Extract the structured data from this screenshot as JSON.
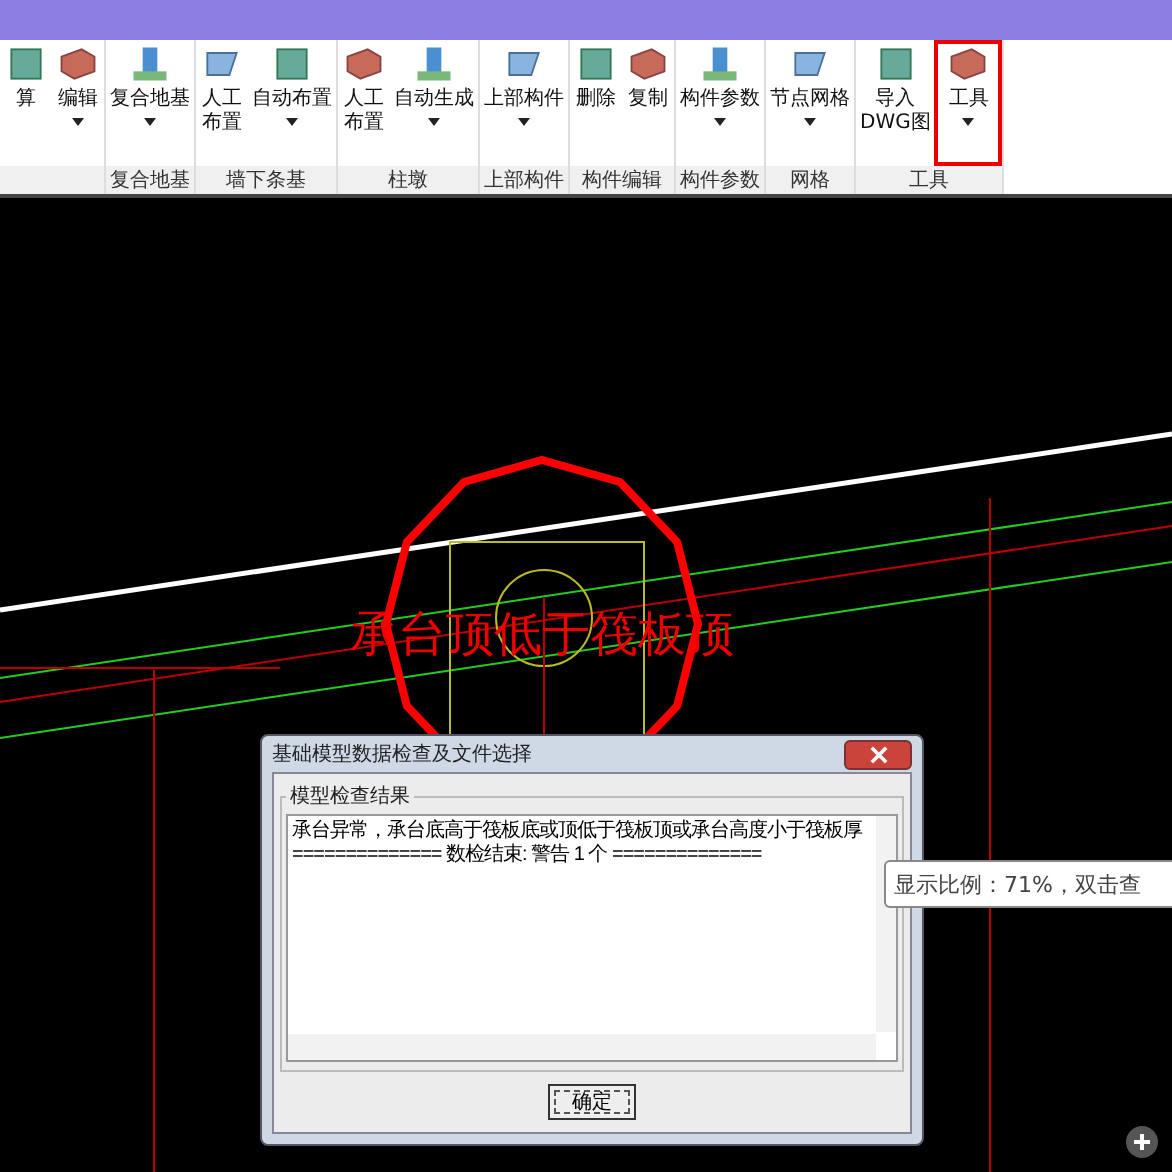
{
  "ribbon": {
    "groups": [
      {
        "buttons": [
          {
            "lines": [
              "算"
            ],
            "dropdown": false,
            "highlighted": false
          },
          {
            "lines": [
              "编辑"
            ],
            "dropdown": true,
            "highlighted": false
          }
        ]
      },
      {
        "label": "复合地基",
        "buttons": [
          {
            "lines": [
              "复合地基"
            ],
            "dropdown": true,
            "highlighted": false
          }
        ]
      },
      {
        "label": "墙下条基",
        "buttons": [
          {
            "lines": [
              "人工",
              "布置"
            ],
            "dropdown": false,
            "highlighted": false
          },
          {
            "lines": [
              "自动布置"
            ],
            "dropdown": true,
            "highlighted": false
          }
        ]
      },
      {
        "label": "柱墩",
        "buttons": [
          {
            "lines": [
              "人工",
              "布置"
            ],
            "dropdown": false,
            "highlighted": false
          },
          {
            "lines": [
              "自动生成"
            ],
            "dropdown": true,
            "highlighted": false
          }
        ]
      },
      {
        "label": "上部构件",
        "buttons": [
          {
            "lines": [
              "上部构件"
            ],
            "dropdown": true,
            "highlighted": false
          }
        ]
      },
      {
        "label": "构件编辑",
        "buttons": [
          {
            "lines": [
              "删除"
            ],
            "dropdown": false,
            "highlighted": false
          },
          {
            "lines": [
              "复制"
            ],
            "dropdown": false,
            "highlighted": false
          }
        ]
      },
      {
        "label": "构件参数",
        "buttons": [
          {
            "lines": [
              "构件参数"
            ],
            "dropdown": true,
            "highlighted": false
          }
        ]
      },
      {
        "label": "网格",
        "buttons": [
          {
            "lines": [
              "节点网格"
            ],
            "dropdown": true,
            "highlighted": false
          }
        ]
      },
      {
        "label": "工具",
        "buttons": [
          {
            "lines": [
              "导入",
              "DWG图"
            ],
            "dropdown": false,
            "highlighted": false
          },
          {
            "lines": [
              "工具"
            ],
            "dropdown": true,
            "highlighted": true
          }
        ]
      }
    ]
  },
  "canvas": {
    "label": "承台顶低于筏板顶"
  },
  "dialog": {
    "title": "基础模型数据检查及文件选择",
    "group_label": "模型检查结果",
    "lines": [
      "承台异常，承台底高于筏板底或顶低于筏板顶或承台高度小于筏板厚",
      "==============  数检结束:  警告  1  个  =============="
    ],
    "ok_button": "确定"
  },
  "tooltip": "显示比例：71%，双击查"
}
